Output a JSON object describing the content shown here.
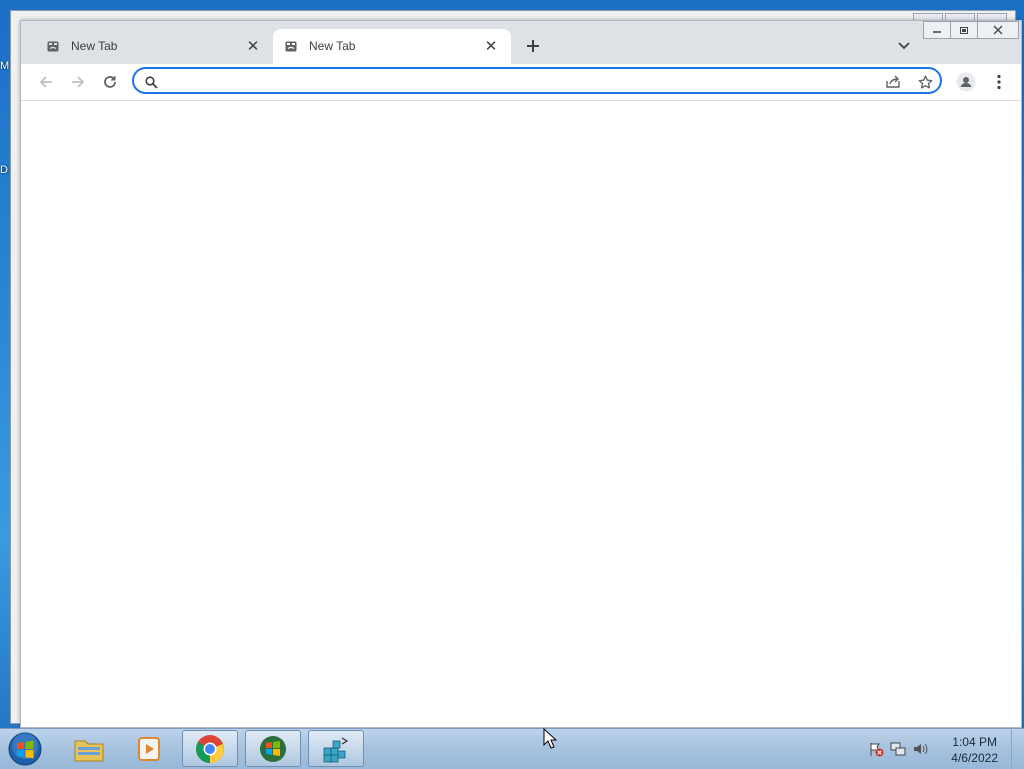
{
  "desktop": {
    "side_labels": [
      "M",
      "D"
    ]
  },
  "browser": {
    "tabs": [
      {
        "title": "New Tab",
        "active": false
      },
      {
        "title": "New Tab",
        "active": true
      }
    ],
    "omnibox": {
      "value": "",
      "placeholder": ""
    },
    "colors": {
      "accent": "#1a73e8",
      "tabstrip": "#dee1e6"
    }
  },
  "taskbar": {
    "apps": [
      "windows-explorer",
      "media-player",
      "google-chrome",
      "windows-logo-app",
      "registry-editor"
    ],
    "clock": {
      "time": "1:04 PM",
      "date": "4/6/2022"
    }
  }
}
